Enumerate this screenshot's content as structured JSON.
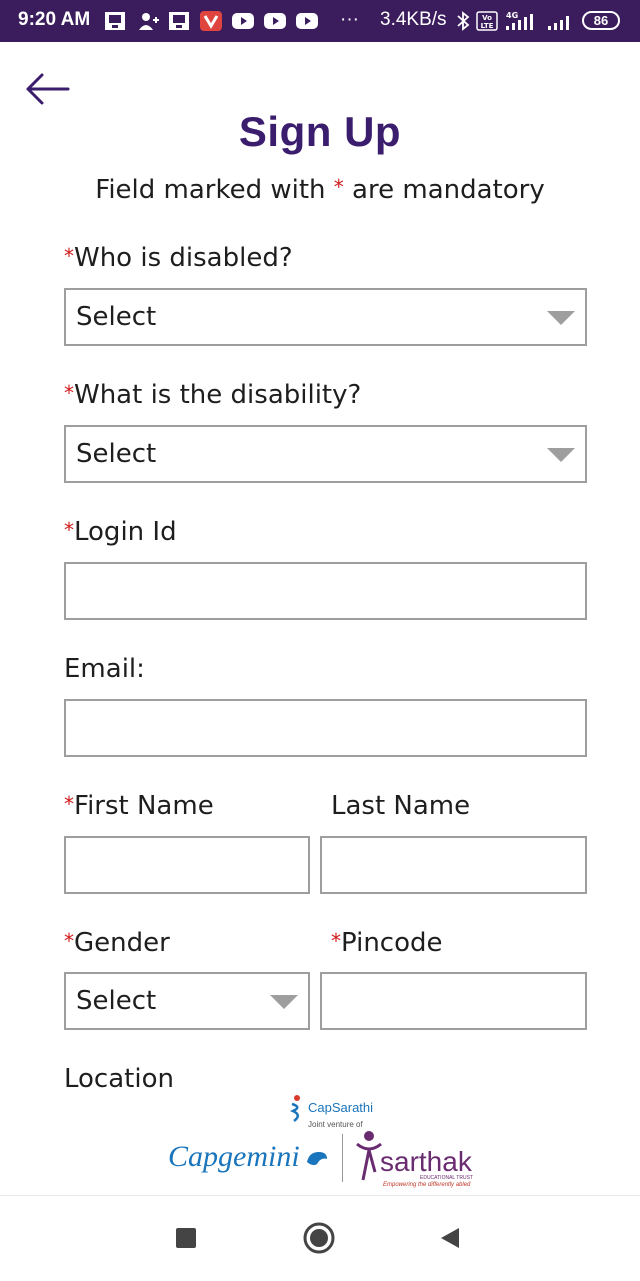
{
  "status_bar": {
    "time": "9:20 AM",
    "network_speed": "3.4KB/s",
    "battery": "86",
    "dots": "···",
    "net_type": "4G",
    "volte": "Vo LTE"
  },
  "header": {
    "back_icon": "arrow-left-icon",
    "title": "Sign Up",
    "subtitle_before": "Field marked with ",
    "subtitle_star": "*",
    "subtitle_after": " are mandatory"
  },
  "form": {
    "required_mark": "*",
    "who_disabled": {
      "label": "Who is disabled?",
      "value": "Select"
    },
    "disability": {
      "label": "What is the disability?",
      "value": "Select"
    },
    "login_id": {
      "label": "Login Id",
      "value": ""
    },
    "email": {
      "label": "Email:",
      "value": ""
    },
    "first_name": {
      "label": "First Name",
      "value": ""
    },
    "last_name": {
      "label": "Last Name",
      "value": ""
    },
    "gender": {
      "label": "Gender",
      "value": "Select"
    },
    "pincode": {
      "label": "Pincode",
      "value": ""
    },
    "location": {
      "label": "Location"
    }
  },
  "footer": {
    "capsarathi": "CapSarathi",
    "joint_venture": "Joint venture of",
    "capgemini": "Capgemini",
    "sarthak": "sarthak",
    "sarthak_sub": "EDUCATIONAL TRUST",
    "sarthak_tag": "Empowering the differently abled"
  },
  "colors": {
    "status_bar": "#3b1d5e",
    "title": "#3b1d6e",
    "required": "#d11c1c",
    "capgemini": "#1a75bc",
    "sarthak": "#6a2c70"
  }
}
